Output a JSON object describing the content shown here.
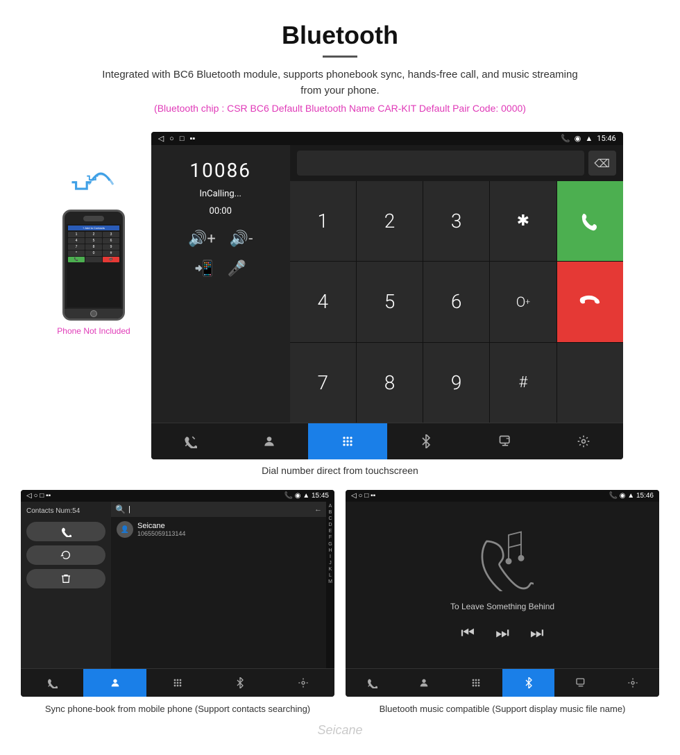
{
  "page": {
    "title": "Bluetooth",
    "subtitle": "Integrated with BC6 Bluetooth module, supports phonebook sync, hands-free call, and music streaming from your phone.",
    "info_line": "(Bluetooth chip : CSR BC6    Default Bluetooth Name CAR-KIT    Default Pair Code: 0000)",
    "dial_caption": "Dial number direct from touchscreen",
    "phone_not_included": "Phone Not Included",
    "bottom_left_caption": "Sync phone-book from mobile phone\n(Support contacts searching)",
    "bottom_right_caption": "Bluetooth music compatible\n(Support display music file name)",
    "watermark": "Seicane"
  },
  "status_bar": {
    "time": "15:46",
    "icons": "📞 🔍 📶"
  },
  "dial_screen": {
    "number": "10086",
    "calling_text": "InCalling...",
    "timer": "00:00",
    "keys": [
      "1",
      "2",
      "3",
      "*",
      "4",
      "5",
      "6",
      "0+",
      "7",
      "8",
      "9",
      "#"
    ],
    "backspace_icon": "⌫",
    "vol_up": "🔊+",
    "vol_down": "🔊-",
    "transfer": "📲",
    "mic": "🎤",
    "call_icon": "📞",
    "end_icon": "📵"
  },
  "contacts_screen": {
    "contacts_num": "Contacts Num:54",
    "search_placeholder": "|",
    "contact_name": "Seicane",
    "contact_number": "10655059113144",
    "alpha_list": [
      "A",
      "B",
      "C",
      "D",
      "E",
      "F",
      "G",
      "H",
      "I",
      "J",
      "K",
      "L",
      "M"
    ]
  },
  "music_screen": {
    "song_title": "To Leave Something Behind",
    "time": "15:46"
  },
  "bottom_icons": {
    "phone": "📞",
    "contacts": "👤",
    "keypad": "⠿",
    "bluetooth": "₿",
    "transfer": "📋",
    "settings": "⚙"
  }
}
